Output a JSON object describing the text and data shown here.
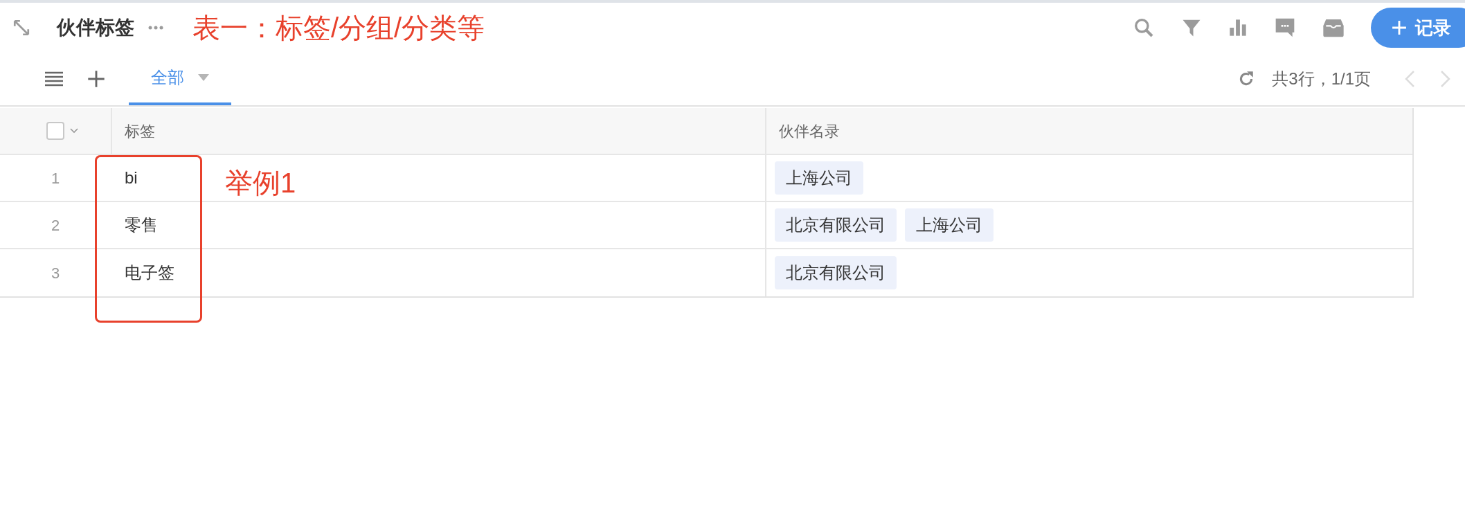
{
  "header": {
    "title": "伙伴标签",
    "annotation": "表一：标签/分组/分类等",
    "add_button": "记录"
  },
  "tabs": [
    {
      "label": "全部",
      "selected": true
    }
  ],
  "pager": {
    "summary": "共3行，1/1页",
    "prev_disabled": true,
    "next_disabled": true
  },
  "table": {
    "select_all": {
      "checked": false
    },
    "columns": [
      "标签",
      "伙伴名录"
    ],
    "rows": [
      {
        "index": "1",
        "tag": "bi",
        "partners": [
          "上海公司"
        ]
      },
      {
        "index": "2",
        "tag": "零售",
        "partners": [
          "北京有限公司",
          "上海公司"
        ]
      },
      {
        "index": "3",
        "tag": "电子签",
        "partners": [
          "北京有限公司"
        ]
      }
    ],
    "annotation": "举例1"
  }
}
